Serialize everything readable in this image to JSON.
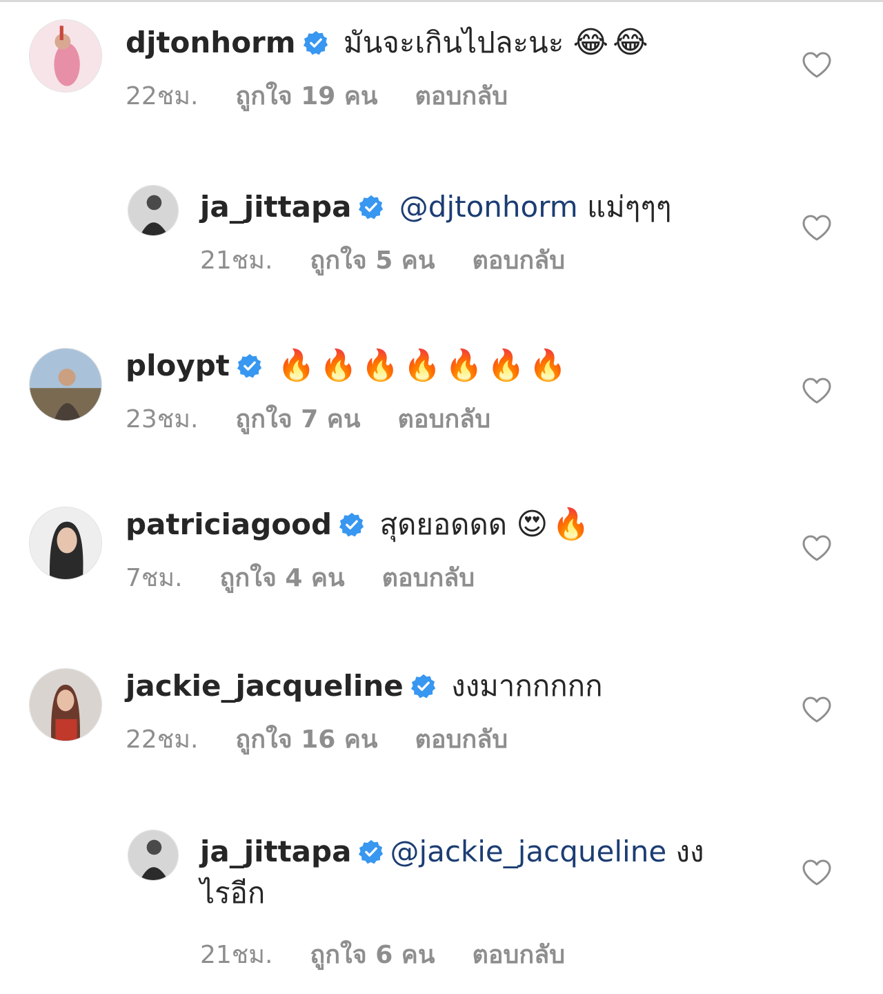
{
  "comments": [
    {
      "username": "djtonhorm",
      "mention": "",
      "text": "มันจะเกินไปละนะ",
      "emoji": "😂😂",
      "time": "22ชม.",
      "likes": "ถูกใจ 19 คน",
      "reply_label": "ตอบกลับ",
      "avatar_color": "#f2c4cf"
    },
    {
      "username": "ja_jittapa",
      "mention": "@djtonhorm",
      "text": "แม่ๆๆๆ",
      "emoji": "",
      "time": "21ชม.",
      "likes": "ถูกใจ 5 คน",
      "reply_label": "ตอบกลับ",
      "avatar_color": "#6d6d6d"
    },
    {
      "username": "ploypt",
      "mention": "",
      "text": "",
      "emoji": "🔥🔥🔥🔥🔥🔥🔥",
      "time": "23ชม.",
      "likes": "ถูกใจ 7 คน",
      "reply_label": "ตอบกลับ",
      "avatar_color": "#8a9bb0"
    },
    {
      "username": "patriciagood",
      "mention": "",
      "text": "สุดยอดดด",
      "emoji": "😍🔥",
      "time": "7ชม.",
      "likes": "ถูกใจ 4 คน",
      "reply_label": "ตอบกลับ",
      "avatar_color": "#3a3a3a"
    },
    {
      "username": "jackie_jacqueline",
      "mention": "",
      "text": "งงมากกกกก",
      "emoji": "",
      "time": "22ชม.",
      "likes": "ถูกใจ 16 คน",
      "reply_label": "ตอบกลับ",
      "avatar_color": "#c97b6e"
    },
    {
      "username": "ja_jittapa",
      "mention": "@jackie_jacqueline",
      "text": "งงไรอีก",
      "emoji": "",
      "time": "21ชม.",
      "likes": "ถูกใจ 6 คน",
      "reply_label": "ตอบกลับ",
      "avatar_color": "#6d6d6d"
    }
  ],
  "colors": {
    "verified_badge": "#3897f0",
    "mention": "#1c3d73",
    "meta_text": "#8e8e8e"
  },
  "icons": {
    "verified": "verified-badge-icon",
    "like": "heart-outline-icon"
  }
}
